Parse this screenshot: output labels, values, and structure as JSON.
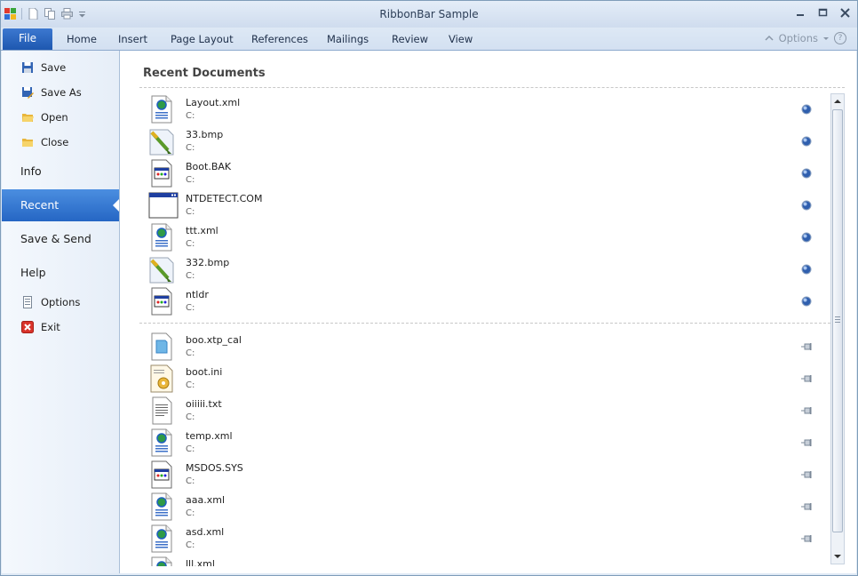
{
  "window": {
    "title": "RibbonBar Sample"
  },
  "ribbon": {
    "file_tab": "File",
    "tabs": [
      "Home",
      "Insert",
      "Page Layout",
      "References",
      "Mailings",
      "Review",
      "View"
    ],
    "options_label": "Options"
  },
  "backstage": {
    "commands": [
      {
        "label": "Save",
        "icon": "save-icon"
      },
      {
        "label": "Save As",
        "icon": "save-as-icon"
      },
      {
        "label": "Open",
        "icon": "open-folder-icon"
      },
      {
        "label": "Close",
        "icon": "close-folder-icon"
      }
    ],
    "sections": [
      {
        "label": "Info",
        "selected": false
      },
      {
        "label": "Recent",
        "selected": true
      },
      {
        "label": "Save & Send",
        "selected": false
      },
      {
        "label": "Help",
        "selected": false
      }
    ],
    "footer_commands": [
      {
        "label": "Options",
        "icon": "options-icon"
      },
      {
        "label": "Exit",
        "icon": "exit-icon"
      }
    ]
  },
  "recent": {
    "heading": "Recent Documents",
    "pinned": [
      {
        "name": "Layout.xml",
        "path": "C:",
        "icon": "xml-file-icon"
      },
      {
        "name": "33.bmp",
        "path": "C:",
        "icon": "bitmap-file-icon"
      },
      {
        "name": "Boot.BAK",
        "path": "C:",
        "icon": "system-file-icon"
      },
      {
        "name": "NTDETECT.COM",
        "path": "C:",
        "icon": "program-window-icon"
      },
      {
        "name": "ttt.xml",
        "path": "C:",
        "icon": "xml-file-icon"
      },
      {
        "name": "332.bmp",
        "path": "C:",
        "icon": "bitmap-file-icon"
      },
      {
        "name": "ntldr",
        "path": "C:",
        "icon": "system-file-icon"
      }
    ],
    "unpinned": [
      {
        "name": "boo.xtp_cal",
        "path": "C:",
        "icon": "calendar-file-icon"
      },
      {
        "name": "boot.ini",
        "path": "C:",
        "icon": "settings-file-icon"
      },
      {
        "name": "oiiiii.txt",
        "path": "C:",
        "icon": "text-file-icon"
      },
      {
        "name": "temp.xml",
        "path": "C:",
        "icon": "xml-file-icon"
      },
      {
        "name": "MSDOS.SYS",
        "path": "C:",
        "icon": "system-file-icon"
      },
      {
        "name": "aaa.xml",
        "path": "C:",
        "icon": "xml-file-icon"
      },
      {
        "name": "asd.xml",
        "path": "C:",
        "icon": "xml-file-icon"
      },
      {
        "name": "lll.xml",
        "path": "",
        "icon": "xml-file-icon"
      }
    ]
  },
  "colors": {
    "accent": "#2566c4",
    "file_tab": "#1e58b0"
  }
}
